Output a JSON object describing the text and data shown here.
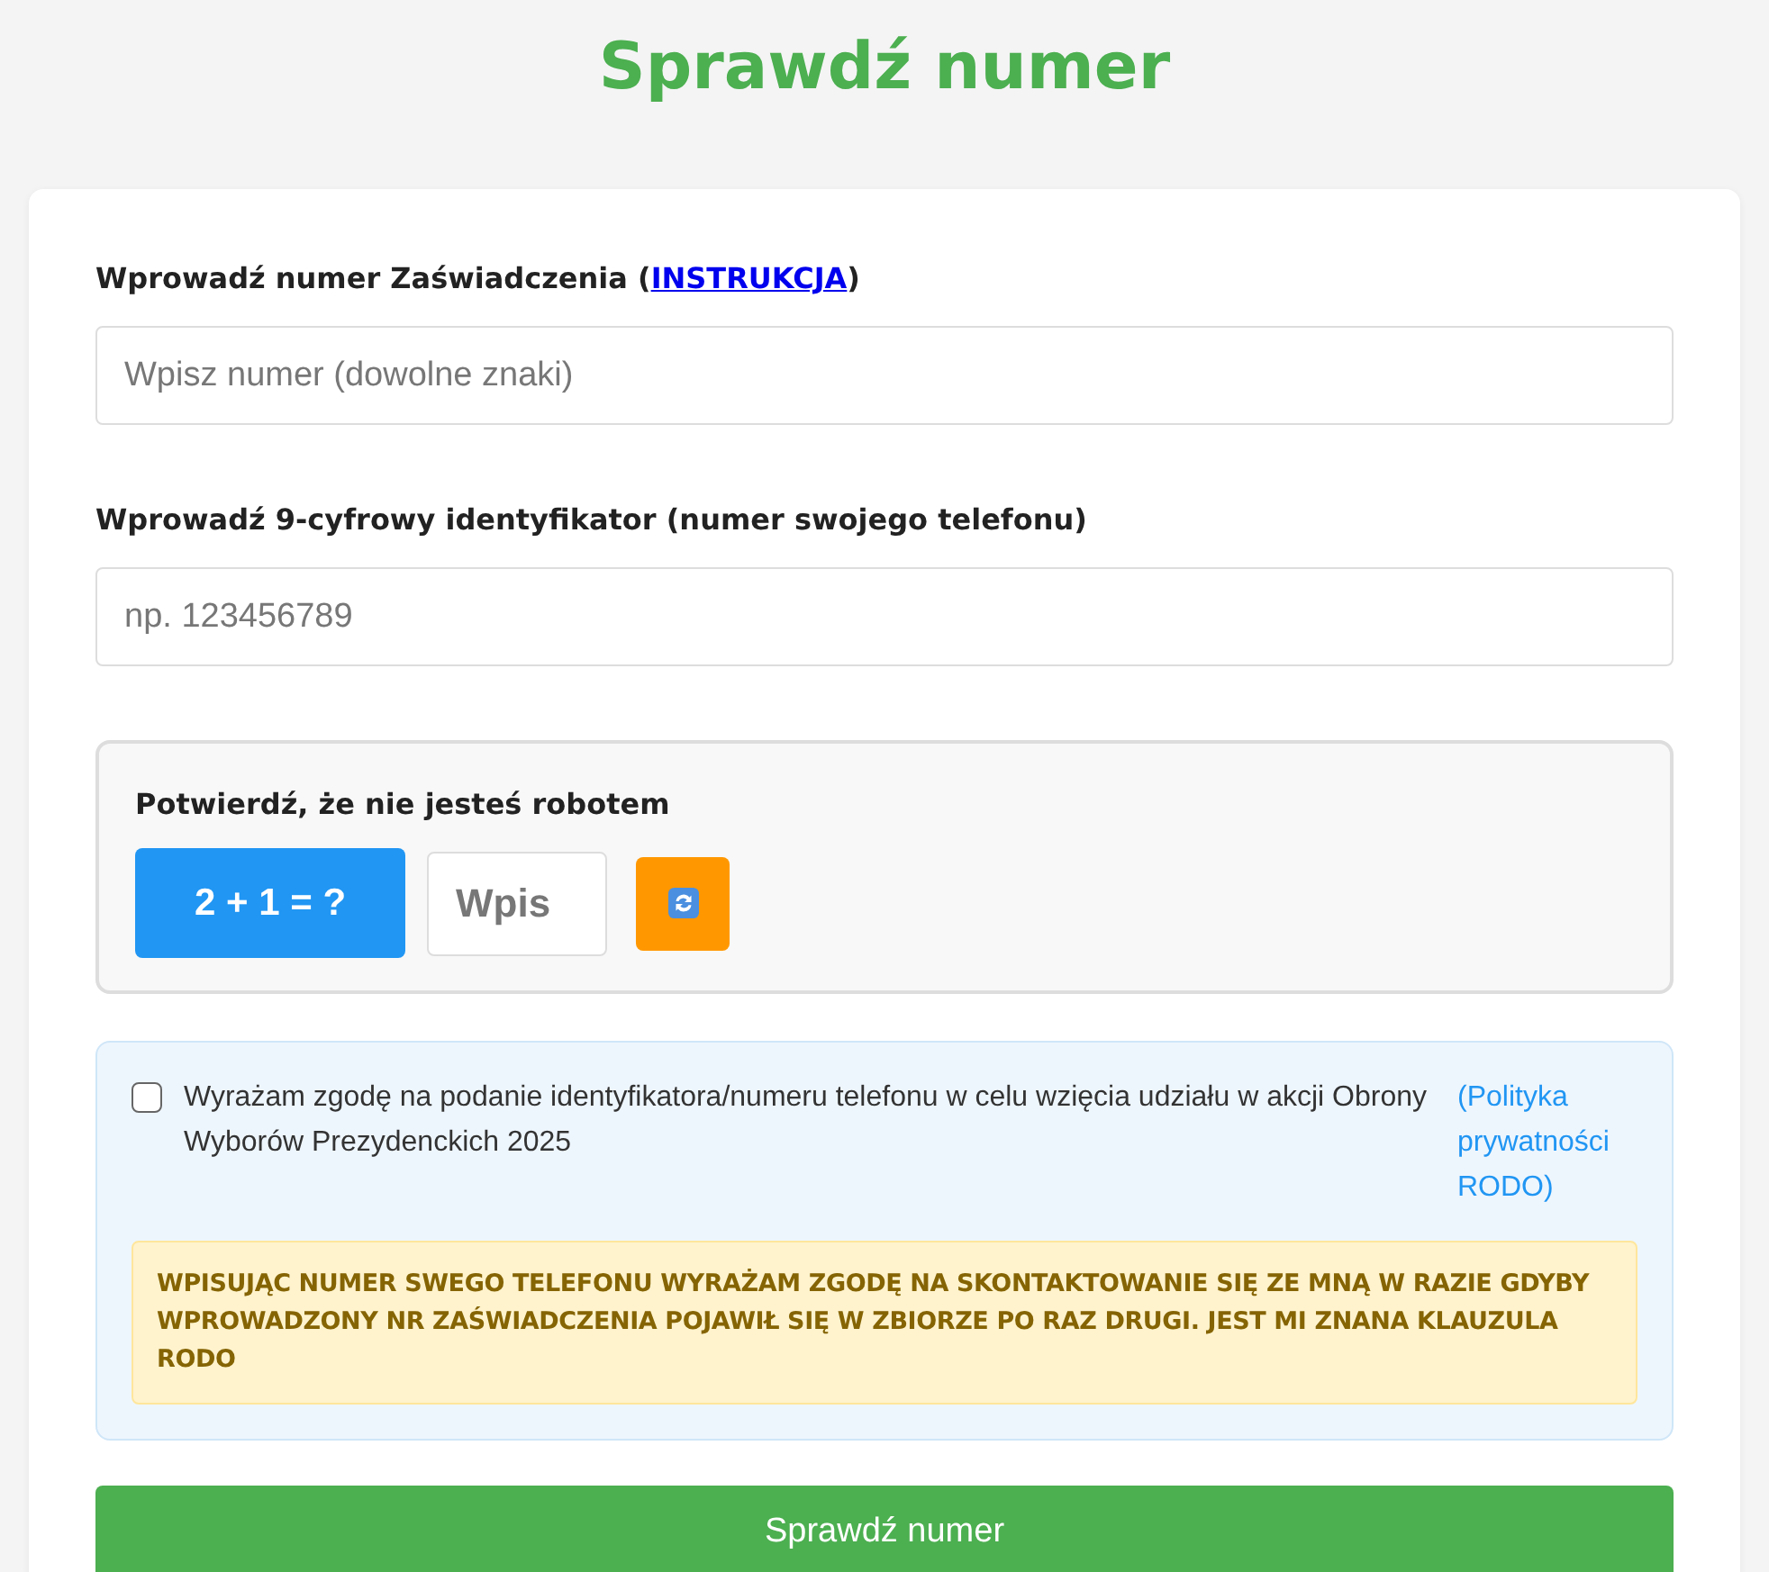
{
  "title": "Sprawdź numer",
  "certificate": {
    "label_before": "Wprowadź numer Zaświadczenia (",
    "link": "INSTRUKCJA",
    "label_after": ")",
    "placeholder": "Wpisz numer (dowolne znaki)"
  },
  "phone": {
    "label": "Wprowadź 9-cyfrowy identyfikator (numer swojego telefonu)",
    "placeholder": "np. 123456789"
  },
  "captcha": {
    "label": "Potwierdź, że nie jesteś robotem",
    "question": "2 + 1 = ?",
    "placeholder": "Wpis"
  },
  "consent": {
    "checked": false,
    "text": "Wyrażam zgodę na podanie identyfikatora/numeru telefonu w celu wzięcia udziału w akcji Obrony Wyborów Prezydenckich 2025",
    "link": "(Polityka prywatności RODO)",
    "notice": "WPISUJĄC NUMER SWEGO TELEFONU WYRAŻAM ZGODĘ NA SKONTAKTOWANIE SIĘ ZE MNĄ W RAZIE GDYBY WPROWADZONY NR ZAŚWIADCZENIA POJAWIŁ SIĘ W ZBIORZE PO RAZ DRUGI. JEST MI ZNANA KLAUZULA RODO"
  },
  "submit": "Sprawdź numer"
}
